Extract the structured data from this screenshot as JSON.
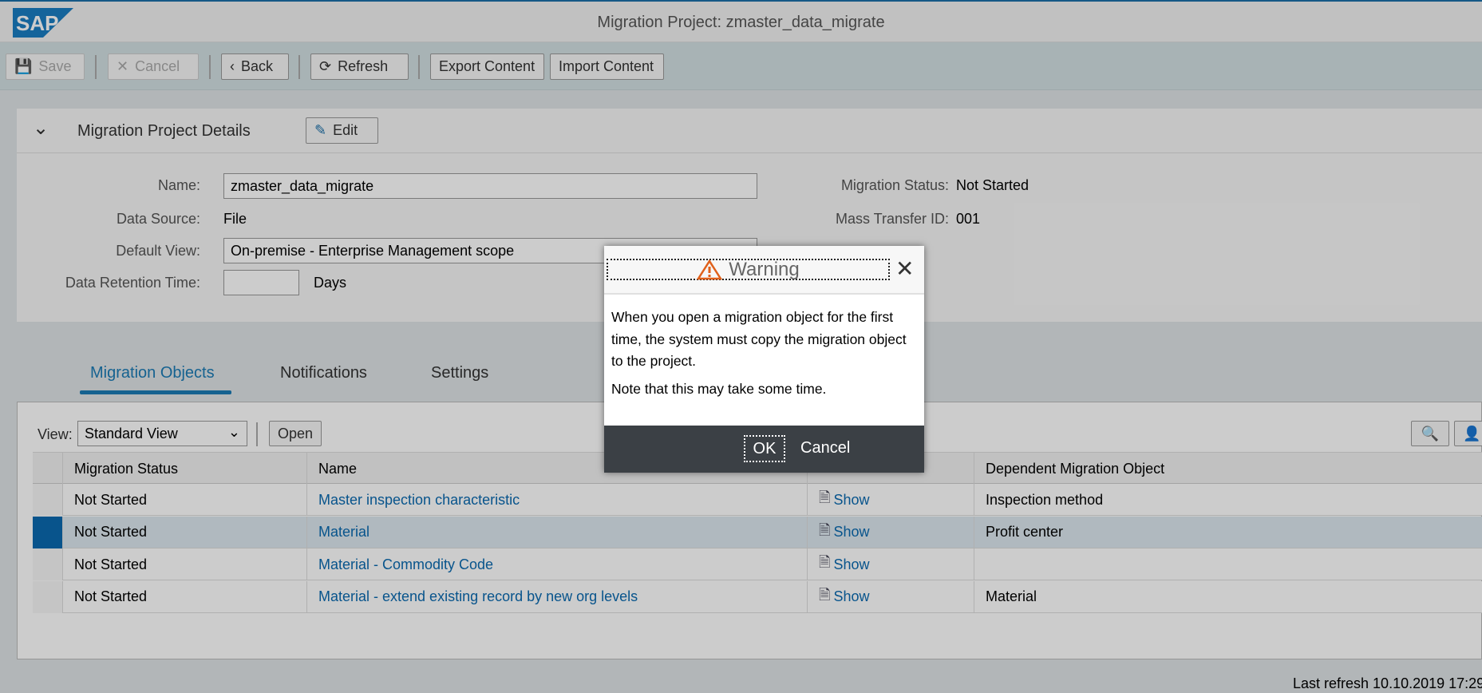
{
  "header": {
    "logo": "SAP",
    "title": "Migration Project: zmaster_data_migrate"
  },
  "toolbar": {
    "save": "Save",
    "cancel": "Cancel",
    "back": "Back",
    "refresh": "Refresh",
    "export": "Export Content",
    "import": "Import Content"
  },
  "panel": {
    "title": "Migration Project Details",
    "edit": "Edit",
    "name_label": "Name:",
    "name_value": "zmaster_data_migrate",
    "source_label": "Data Source:",
    "source_value": "File",
    "view_label": "Default View:",
    "view_value": "On-premise - Enterprise Management scope",
    "retention_label": "Data Retention Time:",
    "retention_value": "",
    "retention_unit": "Days",
    "status_label": "Migration Status:",
    "status_value": "Not Started",
    "mtid_label": "Mass Transfer ID:",
    "mtid_value": "001"
  },
  "tabs": [
    "Migration Objects",
    "Notifications",
    "Settings"
  ],
  "table": {
    "view_label": "View:",
    "view_value": "Standard View",
    "open": "Open",
    "columns": [
      "Migration Status",
      "Name",
      "",
      "Dependent Migration Object"
    ],
    "rows": [
      {
        "status": "Not Started",
        "name": "Master inspection characteristic",
        "doc": "Show",
        "dep": "Inspection method"
      },
      {
        "status": "Not Started",
        "name": "Material",
        "doc": "Show",
        "dep": "Profit center"
      },
      {
        "status": "Not Started",
        "name": "Material - Commodity Code",
        "doc": "Show",
        "dep": ""
      },
      {
        "status": "Not Started",
        "name": "Material - extend existing record by new org levels",
        "doc": "Show",
        "dep": "Material"
      }
    ]
  },
  "footer": {
    "last_refresh": "Last refresh 10.10.2019 17:29"
  },
  "dialog": {
    "title": "Warning",
    "p1": "When you open a migration object for the first time, the system must copy the migration object to the project.",
    "p2": "Note that this may take some time.",
    "ok": "OK",
    "cancel": "Cancel"
  }
}
